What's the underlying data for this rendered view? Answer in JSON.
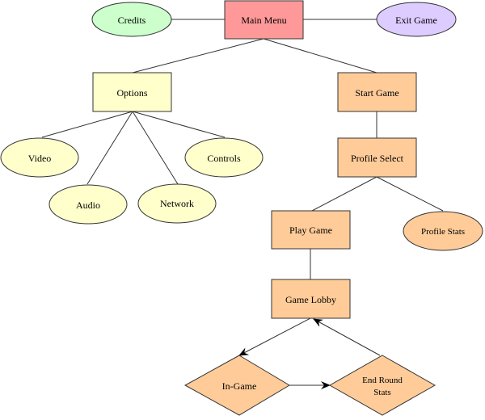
{
  "diagram": {
    "type": "flowchart",
    "colors": {
      "main_menu": "#ff9999",
      "credits": "#ccffcc",
      "exit": "#ddccff",
      "options": "#ffffcc",
      "game_flow": "#ffcc99",
      "stroke": "#333333"
    },
    "nodes": {
      "main_menu": {
        "label": "Main Menu",
        "shape": "rectangle"
      },
      "credits": {
        "label": "Credits",
        "shape": "ellipse"
      },
      "exit_game": {
        "label": "Exit Game",
        "shape": "ellipse"
      },
      "options": {
        "label": "Options",
        "shape": "rectangle"
      },
      "start_game": {
        "label": "Start Game",
        "shape": "rectangle"
      },
      "video": {
        "label": "Video",
        "shape": "ellipse"
      },
      "audio": {
        "label": "Audio",
        "shape": "ellipse"
      },
      "network": {
        "label": "Network",
        "shape": "ellipse"
      },
      "controls": {
        "label": "Controls",
        "shape": "ellipse"
      },
      "profile_select": {
        "label": "Profile Select",
        "shape": "rectangle"
      },
      "play_game": {
        "label": "Play Game",
        "shape": "rectangle"
      },
      "profile_stats": {
        "label": "Profile Stats",
        "shape": "ellipse"
      },
      "game_lobby": {
        "label": "Game Lobby",
        "shape": "rectangle"
      },
      "in_game": {
        "label": "In-Game",
        "shape": "diamond"
      },
      "end_round_stats": {
        "label_line1": "End Round",
        "label_line2": "Stats",
        "shape": "diamond"
      }
    },
    "edges": [
      {
        "from": "Main Menu",
        "to": "Credits",
        "directed": false
      },
      {
        "from": "Main Menu",
        "to": "Exit Game",
        "directed": false
      },
      {
        "from": "Main Menu",
        "to": "Options",
        "directed": false
      },
      {
        "from": "Main Menu",
        "to": "Start Game",
        "directed": false
      },
      {
        "from": "Options",
        "to": "Video",
        "directed": false
      },
      {
        "from": "Options",
        "to": "Audio",
        "directed": false
      },
      {
        "from": "Options",
        "to": "Network",
        "directed": false
      },
      {
        "from": "Options",
        "to": "Controls",
        "directed": false
      },
      {
        "from": "Start Game",
        "to": "Profile Select",
        "directed": false
      },
      {
        "from": "Profile Select",
        "to": "Play Game",
        "directed": false
      },
      {
        "from": "Profile Select",
        "to": "Profile Stats",
        "directed": false
      },
      {
        "from": "Play Game",
        "to": "Game Lobby",
        "directed": false
      },
      {
        "from": "Game Lobby",
        "to": "In-Game",
        "directed": true
      },
      {
        "from": "In-Game",
        "to": "End Round Stats",
        "directed": true
      },
      {
        "from": "End Round Stats",
        "to": "Game Lobby",
        "directed": true
      }
    ]
  }
}
